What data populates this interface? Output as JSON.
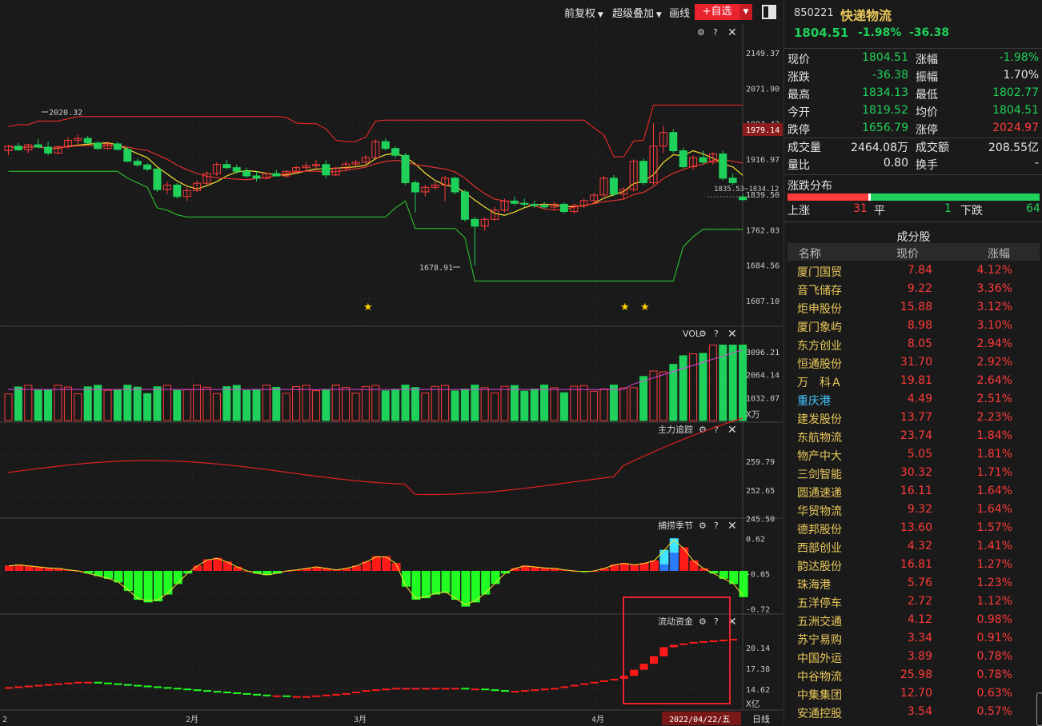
{
  "toolbar": {
    "fuquan": "前复权",
    "overlay": "超级叠加",
    "draw": "画线",
    "add_watch": "+自选"
  },
  "chart": {
    "price_axis": [
      "2149.37",
      "2071.90",
      "1994.43",
      "1916.97",
      "1839.50",
      "1762.03",
      "1684.56",
      "1607.10"
    ],
    "price_marker": "1979.14",
    "hi_label": "2020.32",
    "lo_label": "1678.91",
    "last_label": "1835.53~1834.12",
    "vol_title": "VOL",
    "vol_axis": [
      "3096.21",
      "2064.14",
      "1032.07"
    ],
    "vol_unit": "X万",
    "zl_title": "主力追踪",
    "zl_axis": [
      "259.79",
      "252.65",
      "245.50"
    ],
    "season_title": "捕捞季节",
    "season_axis": [
      "0.62",
      "-0.05",
      "-0.72"
    ],
    "flow_title": "流动资金",
    "flow_axis": [
      "20.14",
      "17.38",
      "14.62"
    ],
    "flow_unit": "X亿",
    "date_labels": [
      "2",
      "2月",
      "3月",
      "4月"
    ],
    "cursor_date": "2022/04/22/五",
    "period": "日线",
    "colors": {
      "up": "#ff3b3b",
      "down": "#1fd15a",
      "ma5": "#f5e22f",
      "boll": "#ff2a2a",
      "lower": "#2ed12e"
    },
    "candles": [
      {
        "o": 1935,
        "h": 1948,
        "l": 1925,
        "c": 1945
      },
      {
        "o": 1945,
        "h": 1952,
        "l": 1935,
        "c": 1937
      },
      {
        "o": 1937,
        "h": 1950,
        "l": 1930,
        "c": 1948
      },
      {
        "o": 1948,
        "h": 1960,
        "l": 1940,
        "c": 1943
      },
      {
        "o": 1943,
        "h": 1955,
        "l": 1925,
        "c": 1930
      },
      {
        "o": 1930,
        "h": 1946,
        "l": 1927,
        "c": 1944
      },
      {
        "o": 1944,
        "h": 1965,
        "l": 1940,
        "c": 1958
      },
      {
        "o": 1958,
        "h": 1970,
        "l": 1950,
        "c": 1962
      },
      {
        "o": 1962,
        "h": 1968,
        "l": 1950,
        "c": 1952
      },
      {
        "o": 1952,
        "h": 1956,
        "l": 1936,
        "c": 1940
      },
      {
        "o": 1940,
        "h": 1954,
        "l": 1938,
        "c": 1950
      },
      {
        "o": 1950,
        "h": 1954,
        "l": 1936,
        "c": 1938
      },
      {
        "o": 1938,
        "h": 1943,
        "l": 1910,
        "c": 1912
      },
      {
        "o": 1912,
        "h": 1918,
        "l": 1900,
        "c": 1904
      },
      {
        "o": 1904,
        "h": 1908,
        "l": 1890,
        "c": 1895
      },
      {
        "o": 1895,
        "h": 1897,
        "l": 1845,
        "c": 1850
      },
      {
        "o": 1850,
        "h": 1868,
        "l": 1840,
        "c": 1860
      },
      {
        "o": 1860,
        "h": 1864,
        "l": 1830,
        "c": 1835
      },
      {
        "o": 1835,
        "h": 1855,
        "l": 1825,
        "c": 1848
      },
      {
        "o": 1848,
        "h": 1870,
        "l": 1845,
        "c": 1864
      },
      {
        "o": 1864,
        "h": 1890,
        "l": 1860,
        "c": 1885
      },
      {
        "o": 1885,
        "h": 1910,
        "l": 1880,
        "c": 1905
      },
      {
        "o": 1905,
        "h": 1915,
        "l": 1895,
        "c": 1898
      },
      {
        "o": 1898,
        "h": 1905,
        "l": 1885,
        "c": 1890
      },
      {
        "o": 1890,
        "h": 1898,
        "l": 1875,
        "c": 1880
      },
      {
        "o": 1880,
        "h": 1890,
        "l": 1868,
        "c": 1875
      },
      {
        "o": 1875,
        "h": 1888,
        "l": 1872,
        "c": 1885
      },
      {
        "o": 1885,
        "h": 1893,
        "l": 1878,
        "c": 1880
      },
      {
        "o": 1880,
        "h": 1892,
        "l": 1876,
        "c": 1890
      },
      {
        "o": 1890,
        "h": 1902,
        "l": 1885,
        "c": 1898
      },
      {
        "o": 1898,
        "h": 1910,
        "l": 1890,
        "c": 1902
      },
      {
        "o": 1902,
        "h": 1915,
        "l": 1895,
        "c": 1905
      },
      {
        "o": 1905,
        "h": 1914,
        "l": 1875,
        "c": 1882
      },
      {
        "o": 1882,
        "h": 1900,
        "l": 1880,
        "c": 1897
      },
      {
        "o": 1897,
        "h": 1912,
        "l": 1890,
        "c": 1906
      },
      {
        "o": 1906,
        "h": 1915,
        "l": 1900,
        "c": 1910
      },
      {
        "o": 1910,
        "h": 1925,
        "l": 1905,
        "c": 1920
      },
      {
        "o": 1920,
        "h": 1960,
        "l": 1918,
        "c": 1955
      },
      {
        "o": 1955,
        "h": 1962,
        "l": 1935,
        "c": 1940
      },
      {
        "o": 1940,
        "h": 1945,
        "l": 1920,
        "c": 1925
      },
      {
        "o": 1925,
        "h": 1930,
        "l": 1860,
        "c": 1865
      },
      {
        "o": 1865,
        "h": 1870,
        "l": 1800,
        "c": 1845
      },
      {
        "o": 1845,
        "h": 1860,
        "l": 1835,
        "c": 1855
      },
      {
        "o": 1855,
        "h": 1866,
        "l": 1850,
        "c": 1860
      },
      {
        "o": 1860,
        "h": 1880,
        "l": 1825,
        "c": 1875
      },
      {
        "o": 1875,
        "h": 1878,
        "l": 1840,
        "c": 1845
      },
      {
        "o": 1845,
        "h": 1850,
        "l": 1780,
        "c": 1785
      },
      {
        "o": 1785,
        "h": 1790,
        "l": 1685,
        "c": 1770
      },
      {
        "o": 1770,
        "h": 1790,
        "l": 1760,
        "c": 1785
      },
      {
        "o": 1785,
        "h": 1812,
        "l": 1782,
        "c": 1805
      },
      {
        "o": 1805,
        "h": 1830,
        "l": 1800,
        "c": 1825
      },
      {
        "o": 1825,
        "h": 1835,
        "l": 1815,
        "c": 1820
      },
      {
        "o": 1820,
        "h": 1830,
        "l": 1812,
        "c": 1818
      },
      {
        "o": 1818,
        "h": 1826,
        "l": 1810,
        "c": 1815
      },
      {
        "o": 1815,
        "h": 1823,
        "l": 1808,
        "c": 1812
      },
      {
        "o": 1812,
        "h": 1822,
        "l": 1805,
        "c": 1818
      },
      {
        "o": 1818,
        "h": 1822,
        "l": 1798,
        "c": 1802
      },
      {
        "o": 1802,
        "h": 1820,
        "l": 1798,
        "c": 1815
      },
      {
        "o": 1815,
        "h": 1830,
        "l": 1810,
        "c": 1826
      },
      {
        "o": 1826,
        "h": 1842,
        "l": 1820,
        "c": 1838
      },
      {
        "o": 1838,
        "h": 1880,
        "l": 1835,
        "c": 1875
      },
      {
        "o": 1875,
        "h": 1882,
        "l": 1835,
        "c": 1840
      },
      {
        "o": 1840,
        "h": 1855,
        "l": 1828,
        "c": 1850
      },
      {
        "o": 1850,
        "h": 1916,
        "l": 1846,
        "c": 1912
      },
      {
        "o": 1912,
        "h": 1918,
        "l": 1860,
        "c": 1865
      },
      {
        "o": 1865,
        "h": 1995,
        "l": 1860,
        "c": 1945
      },
      {
        "o": 1945,
        "h": 1990,
        "l": 1930,
        "c": 1975
      },
      {
        "o": 1975,
        "h": 1982,
        "l": 1930,
        "c": 1935
      },
      {
        "o": 1935,
        "h": 1942,
        "l": 1895,
        "c": 1900
      },
      {
        "o": 1900,
        "h": 1925,
        "l": 1893,
        "c": 1920
      },
      {
        "o": 1920,
        "h": 1935,
        "l": 1905,
        "c": 1910
      },
      {
        "o": 1910,
        "h": 1932,
        "l": 1905,
        "c": 1928
      },
      {
        "o": 1928,
        "h": 1935,
        "l": 1870,
        "c": 1875
      },
      {
        "o": 1875,
        "h": 1885,
        "l": 1860,
        "c": 1865
      },
      {
        "o": 1834,
        "h": 1840,
        "l": 1825,
        "c": 1828
      }
    ],
    "season": [
      0.1,
      0.12,
      0.1,
      0.08,
      0.06,
      0.05,
      0.02,
      0,
      -0.05,
      -0.1,
      -0.15,
      -0.22,
      -0.38,
      -0.55,
      -0.6,
      -0.58,
      -0.45,
      -0.25,
      -0.05,
      0.1,
      0.22,
      0.25,
      0.18,
      0.08,
      0,
      -0.05,
      -0.08,
      -0.05,
      0,
      0.02,
      0.05,
      0.08,
      0.05,
      0.02,
      0.05,
      0.1,
      0.18,
      0.28,
      0.28,
      0.15,
      -0.3,
      -0.55,
      -0.52,
      -0.45,
      -0.42,
      -0.55,
      -0.68,
      -0.6,
      -0.45,
      -0.25,
      -0.05,
      0.05,
      0.1,
      0.08,
      0.06,
      0.05,
      0.02,
      0,
      -0.02,
      0,
      0.05,
      0.12,
      0.15,
      0.12,
      0.15,
      0.2,
      0.4,
      0.62,
      0.45,
      0.2,
      0.05,
      -0.05,
      -0.15,
      -0.25,
      -0.5
    ],
    "flow": [
      14.9,
      15.0,
      15.1,
      15.2,
      15.3,
      15.4,
      15.5,
      15.6,
      15.6,
      15.5,
      15.4,
      15.3,
      15.2,
      15.1,
      15.0,
      14.9,
      14.8,
      14.7,
      14.6,
      14.5,
      14.4,
      14.3,
      14.2,
      14.1,
      14.0,
      13.9,
      13.8,
      13.8,
      13.7,
      13.7,
      13.7,
      13.8,
      13.9,
      14.0,
      14.1,
      14.3,
      14.5,
      14.6,
      14.7,
      14.8,
      14.8,
      14.8,
      14.8,
      14.8,
      14.8,
      14.8,
      14.7,
      14.7,
      14.6,
      14.5,
      14.4,
      14.4,
      14.5,
      14.6,
      14.7,
      14.8,
      15.0,
      15.2,
      15.4,
      15.6,
      15.8,
      16.0,
      16.4,
      17.2,
      18.0,
      19.0,
      20.2,
      20.5,
      20.7,
      20.9,
      21.0,
      21.1,
      21.2,
      21.3
    ]
  },
  "quote": {
    "code": "850221",
    "name": "快递物流",
    "price": "1804.51",
    "pct": "-1.98%",
    "chg": "-36.38",
    "rows": [
      {
        "l1": "现价",
        "v1": "1804.51",
        "c1": "g",
        "l2": "涨幅",
        "v2": "-1.98%",
        "c2": "g"
      },
      {
        "l1": "涨跌",
        "v1": "-36.38",
        "c1": "g",
        "l2": "振幅",
        "v2": "1.70%",
        "c2": "w"
      },
      {
        "l1": "最高",
        "v1": "1834.13",
        "c1": "g",
        "l2": "最低",
        "v2": "1802.77",
        "c2": "g"
      },
      {
        "l1": "今开",
        "v1": "1819.52",
        "c1": "g",
        "l2": "均价",
        "v2": "1804.51",
        "c2": "g"
      },
      {
        "l1": "跌停",
        "v1": "1656.79",
        "c1": "g",
        "l2": "涨停",
        "v2": "2024.97",
        "c2": "r"
      },
      {
        "l1": "成交量",
        "v1": "2464.08万",
        "c1": "w",
        "l2": "成交额",
        "v2": "208.55亿",
        "c2": "w"
      },
      {
        "l1": "量比",
        "v1": "0.80",
        "c1": "w",
        "l2": "换手",
        "v2": "-",
        "c2": "w"
      }
    ],
    "dist_title": "涨跌分布",
    "up_label": "上涨",
    "up": "31",
    "flat_label": "平",
    "flat": "1",
    "down_label": "下跌",
    "down": "64"
  },
  "constituents": {
    "title": "成分股",
    "headers": [
      "名称",
      "现价",
      "涨幅"
    ],
    "rows": [
      {
        "name": "厦门国贸",
        "price": "7.84",
        "pct": "4.12%"
      },
      {
        "name": "音飞储存",
        "price": "9.22",
        "pct": "3.36%"
      },
      {
        "name": "炬申股份",
        "price": "15.88",
        "pct": "3.12%"
      },
      {
        "name": "厦门象屿",
        "price": "8.98",
        "pct": "3.10%"
      },
      {
        "name": "东方创业",
        "price": "8.05",
        "pct": "2.94%"
      },
      {
        "name": "恒通股份",
        "price": "31.70",
        "pct": "2.92%"
      },
      {
        "name": "万　科Ａ",
        "price": "19.81",
        "pct": "2.64%"
      },
      {
        "name": "重庆港",
        "price": "4.49",
        "pct": "2.51%"
      },
      {
        "name": "建发股份",
        "price": "13.77",
        "pct": "2.23%"
      },
      {
        "name": "东航物流",
        "price": "23.74",
        "pct": "1.84%"
      },
      {
        "name": "物产中大",
        "price": "5.05",
        "pct": "1.81%"
      },
      {
        "name": "三剑智能",
        "price": "30.32",
        "pct": "1.71%"
      },
      {
        "name": "圆通速递",
        "price": "16.11",
        "pct": "1.64%"
      },
      {
        "name": "华贸物流",
        "price": "9.32",
        "pct": "1.64%"
      },
      {
        "name": "德邦股份",
        "price": "13.60",
        "pct": "1.57%"
      },
      {
        "name": "西部创业",
        "price": "4.32",
        "pct": "1.41%"
      },
      {
        "name": "韵达股份",
        "price": "16.81",
        "pct": "1.27%"
      },
      {
        "name": "珠海港",
        "price": "5.76",
        "pct": "1.23%"
      },
      {
        "name": "五洋停车",
        "price": "2.72",
        "pct": "1.12%"
      },
      {
        "name": "五洲交通",
        "price": "4.12",
        "pct": "0.98%"
      },
      {
        "name": "苏宁易购",
        "price": "3.34",
        "pct": "0.91%"
      },
      {
        "name": "中国外运",
        "price": "3.89",
        "pct": "0.78%"
      },
      {
        "name": "中谷物流",
        "price": "25.98",
        "pct": "0.78%"
      },
      {
        "name": "中集集团",
        "price": "12.70",
        "pct": "0.63%"
      },
      {
        "name": "安通控股",
        "price": "3.54",
        "pct": "0.57%"
      }
    ]
  }
}
